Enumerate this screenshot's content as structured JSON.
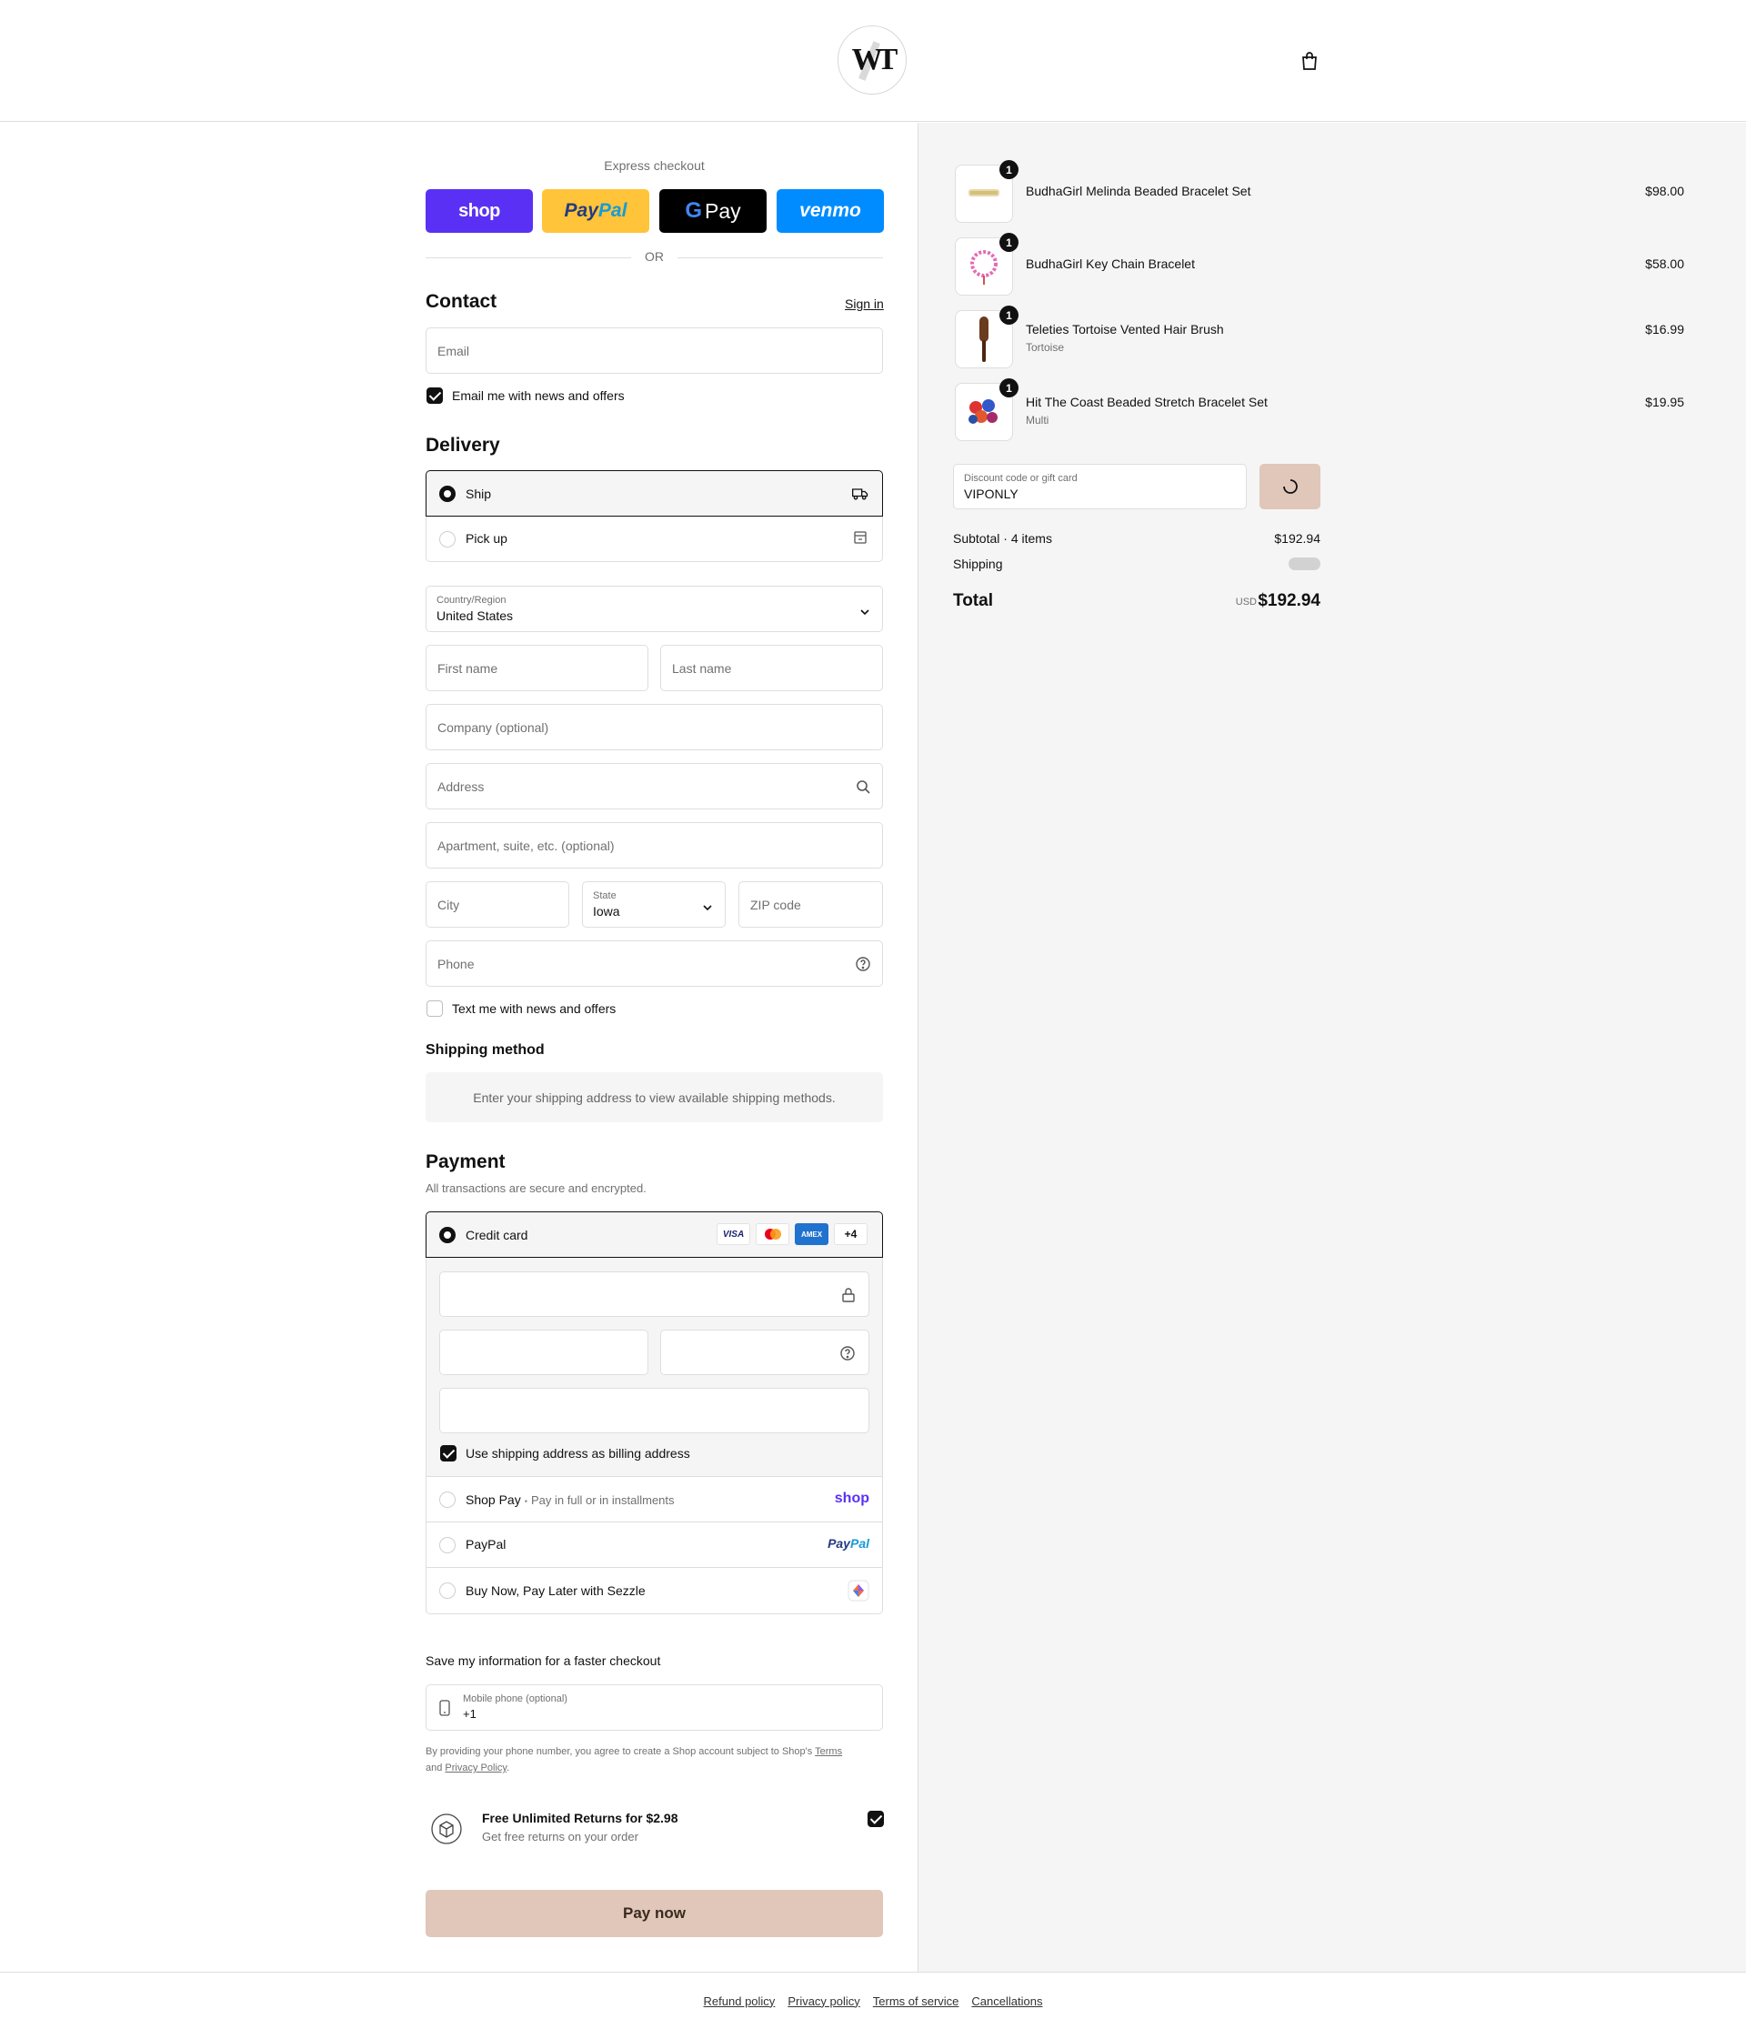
{
  "header": {
    "logo_text": "WT"
  },
  "express": {
    "title": "Express checkout",
    "shop_label": "shop",
    "paypal_a": "Pay",
    "paypal_b": "Pal",
    "gpay_g": "G",
    "gpay_label": "Pay",
    "venmo_label": "venmo",
    "or_label": "OR"
  },
  "contact": {
    "title": "Contact",
    "sign_in": "Sign in",
    "email_placeholder": "Email",
    "news_label": "Email me with news and offers"
  },
  "delivery": {
    "title": "Delivery",
    "ship_label": "Ship",
    "pickup_label": "Pick up",
    "country_label": "Country/Region",
    "country_value": "United States",
    "first_name": "First name",
    "last_name": "Last name",
    "company": "Company (optional)",
    "address": "Address",
    "apartment": "Apartment, suite, etc. (optional)",
    "city": "City",
    "state_label": "State",
    "state_value": "Iowa",
    "zip": "ZIP code",
    "phone": "Phone",
    "text_label": "Text me with news and offers"
  },
  "shipping_method": {
    "title": "Shipping method",
    "info": "Enter your shipping address to view available shipping methods."
  },
  "payment": {
    "title": "Payment",
    "subtitle": "All transactions are secure and encrypted.",
    "credit_card": "Credit card",
    "card_logos": [
      "VISA",
      "",
      "AMEX",
      "+4"
    ],
    "billing_label": "Use shipping address as billing address",
    "shop_pay": "Shop Pay",
    "shop_pay_sep": "•",
    "shop_pay_sub": "Pay in full or in installments",
    "shop_pay_logo": "shop",
    "paypal": "PayPal",
    "paypal_logo_a": "Pay",
    "paypal_logo_b": "Pal",
    "sezzle": "Buy Now, Pay Later with Sezzle"
  },
  "save_info": {
    "title": "Save my information for a faster checkout",
    "mobile_label": "Mobile phone (optional)",
    "mobile_value": "+1",
    "legal_1": "By providing your phone number, you agree to create a Shop account subject to Shop's ",
    "terms": "Terms",
    "legal_2": "and ",
    "privacy": "Privacy Policy",
    "legal_3": "."
  },
  "returns": {
    "title": "Free Unlimited Returns for $2.98",
    "subtitle": "Get free returns on your order"
  },
  "pay_now": "Pay now",
  "cart": {
    "items": [
      {
        "name": "BudhaGirl Melinda Beaded Bracelet Set",
        "variant": "",
        "price": "$98.00",
        "qty": "1"
      },
      {
        "name": "BudhaGirl Key Chain Bracelet",
        "variant": "",
        "price": "$58.00",
        "qty": "1"
      },
      {
        "name": "Teleties Tortoise Vented Hair Brush",
        "variant": "Tortoise",
        "price": "$16.99",
        "qty": "1"
      },
      {
        "name": "Hit The Coast Beaded Stretch Bracelet Set",
        "variant": "Multi",
        "price": "$19.95",
        "qty": "1"
      }
    ],
    "discount_label": "Discount code or gift card",
    "discount_value": "VIPONLY",
    "subtotal_label": "Subtotal · 4 items",
    "subtotal_value": "$192.94",
    "shipping_label": "Shipping",
    "total_label": "Total",
    "currency": "USD",
    "total_value": "$192.94"
  },
  "footer": {
    "links": [
      "Refund policy",
      "Privacy policy",
      "Terms of service",
      "Cancellations"
    ]
  },
  "colors": {
    "shop": "#5a31f4",
    "paypal": "#ffc439",
    "venmo": "#008cff",
    "pay_now": "#e0c7b9"
  }
}
